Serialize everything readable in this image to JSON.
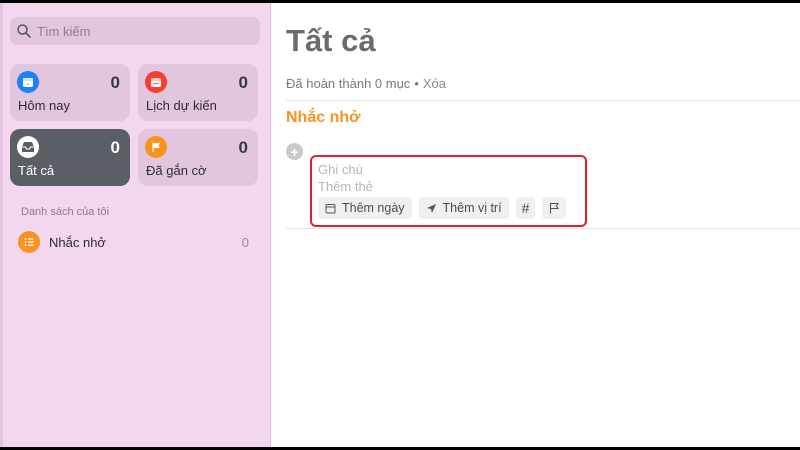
{
  "sidebar": {
    "search": {
      "placeholder": "Tìm kiếm"
    },
    "smart_lists": [
      {
        "label": "Hôm nay",
        "count": "0",
        "icon": "calendar-today-icon",
        "color": "#1a82fb"
      },
      {
        "label": "Lịch dự kiến",
        "count": "0",
        "icon": "calendar-scheduled-icon",
        "color": "#ff3b30"
      },
      {
        "label": "Tất cả",
        "count": "0",
        "icon": "tray-icon",
        "color": "#5a5f66",
        "selected": true
      },
      {
        "label": "Đã gắn cờ",
        "count": "0",
        "icon": "flag-icon",
        "color": "#f7931e"
      }
    ],
    "section_title": "Danh sách của tôi",
    "my_lists": [
      {
        "name": "Nhắc nhở",
        "count": "0",
        "icon": "list-bullets-icon",
        "color": "#f7931e"
      }
    ]
  },
  "main": {
    "title": "Tất cả",
    "completed_text": "Đã hoàn thành 0 mục",
    "separator": "•",
    "clear_label": "Xóa",
    "group_title": "Nhắc nhở",
    "new_reminder": {
      "notes_placeholder": "Ghi chú",
      "tags_placeholder": "Thêm thẻ",
      "add_date_label": "Thêm ngày",
      "add_location_label": "Thêm vị trí",
      "tag_button_label": "#"
    }
  },
  "colors": {
    "accent_orange": "#f7931e",
    "sidebar_bg": "#f2d7ee",
    "highlight_border": "#e0202a"
  }
}
